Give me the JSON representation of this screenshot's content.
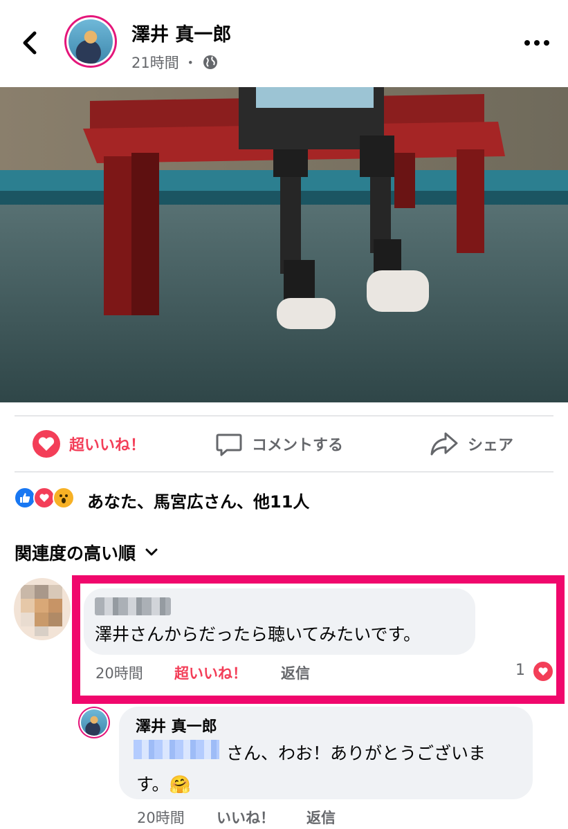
{
  "header": {
    "author": "澤井 真一郎",
    "time": "21時間",
    "separator": "・"
  },
  "actions": {
    "love_label": "超いいね！",
    "comment_label": "コメントする",
    "share_label": "シェア"
  },
  "reactions": {
    "summary": "あなた、馬宮広さん、他11人"
  },
  "sort": {
    "label": "関連度の高い順"
  },
  "comment1": {
    "text": "澤井さんからだったら聴いてみたいです。",
    "time": "20時間",
    "love_label": "超いいね！",
    "reply_label": "返信",
    "reaction_count": "1"
  },
  "reply1": {
    "author": "澤井 真一郎",
    "text_line1": "さん、わお！ありがとうございま",
    "text_line2": "す。🤗",
    "time": "20時間",
    "like_label": "いいね！",
    "reply_label": "返信"
  },
  "colors": {
    "love": "#f33e58",
    "like": "#1877f2",
    "highlight": "#f0076c",
    "avatar_ring": "#e4167a"
  }
}
